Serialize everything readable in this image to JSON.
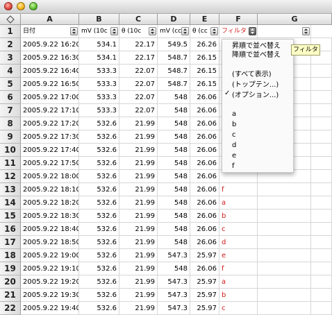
{
  "window": {
    "title": ""
  },
  "columns": [
    "",
    "A",
    "B",
    "C",
    "D",
    "E",
    "F",
    "G"
  ],
  "corner_icon": "diamond-icon",
  "header_row": {
    "row_number": "1",
    "cells": [
      "日付",
      "mV (10c",
      "θ (10c",
      "mV (cc",
      "θ (cc",
      "フィルタ",
      ""
    ]
  },
  "rows": [
    {
      "num": "2",
      "date": "2005.9.22 16:20",
      "b": "534.1",
      "c": "22.17",
      "d": "549.5",
      "e": "26.26",
      "f": ""
    },
    {
      "num": "3",
      "date": "2005.9.22 16:30",
      "b": "534.1",
      "c": "22.17",
      "d": "548.7",
      "e": "26.15",
      "f": ""
    },
    {
      "num": "4",
      "date": "2005.9.22 16:40",
      "b": "533.3",
      "c": "22.07",
      "d": "548.7",
      "e": "26.15",
      "f": ""
    },
    {
      "num": "5",
      "date": "2005.9.22 16:50",
      "b": "533.3",
      "c": "22.07",
      "d": "548.7",
      "e": "26.15",
      "f": ""
    },
    {
      "num": "6",
      "date": "2005.9.22 17:00",
      "b": "533.3",
      "c": "22.07",
      "d": "548",
      "e": "26.06",
      "f": ""
    },
    {
      "num": "7",
      "date": "2005.9.22 17:10",
      "b": "533.3",
      "c": "22.07",
      "d": "548",
      "e": "26.06",
      "f": ""
    },
    {
      "num": "8",
      "date": "2005.9.22 17:20",
      "b": "532.6",
      "c": "21.99",
      "d": "548",
      "e": "26.06",
      "f": ""
    },
    {
      "num": "9",
      "date": "2005.9.22 17:30",
      "b": "532.6",
      "c": "21.99",
      "d": "548",
      "e": "26.06",
      "f": ""
    },
    {
      "num": "10",
      "date": "2005.9.22 17:40",
      "b": "532.6",
      "c": "21.99",
      "d": "548",
      "e": "26.06",
      "f": ""
    },
    {
      "num": "11",
      "date": "2005.9.22 17:50",
      "b": "532.6",
      "c": "21.99",
      "d": "548",
      "e": "26.06",
      "f": ""
    },
    {
      "num": "12",
      "date": "2005.9.22 18:00",
      "b": "532.6",
      "c": "21.99",
      "d": "548",
      "e": "26.06",
      "f": ""
    },
    {
      "num": "13",
      "date": "2005.9.22 18:10",
      "b": "532.6",
      "c": "21.99",
      "d": "548",
      "e": "26.06",
      "f": "f"
    },
    {
      "num": "14",
      "date": "2005.9.22 18:20",
      "b": "532.6",
      "c": "21.99",
      "d": "548",
      "e": "26.06",
      "f": "a"
    },
    {
      "num": "15",
      "date": "2005.9.22 18:30",
      "b": "532.6",
      "c": "21.99",
      "d": "548",
      "e": "26.06",
      "f": "b"
    },
    {
      "num": "16",
      "date": "2005.9.22 18:40",
      "b": "532.6",
      "c": "21.99",
      "d": "548",
      "e": "26.06",
      "f": "c"
    },
    {
      "num": "17",
      "date": "2005.9.22 18:50",
      "b": "532.6",
      "c": "21.99",
      "d": "548",
      "e": "26.06",
      "f": "d"
    },
    {
      "num": "18",
      "date": "2005.9.22 19:00",
      "b": "532.6",
      "c": "21.99",
      "d": "547.3",
      "e": "25.97",
      "f": "e"
    },
    {
      "num": "19",
      "date": "2005.9.22 19:10",
      "b": "532.6",
      "c": "21.99",
      "d": "548",
      "e": "26.06",
      "f": "f"
    },
    {
      "num": "20",
      "date": "2005.9.22 19:20",
      "b": "532.6",
      "c": "21.99",
      "d": "547.3",
      "e": "25.97",
      "f": "a"
    },
    {
      "num": "21",
      "date": "2005.9.22 19:30",
      "b": "532.6",
      "c": "21.99",
      "d": "547.3",
      "e": "25.97",
      "f": "b"
    },
    {
      "num": "22",
      "date": "2005.9.22 19:40",
      "b": "532.6",
      "c": "21.99",
      "d": "547.3",
      "e": "25.97",
      "f": "c"
    }
  ],
  "filter_menu": {
    "items": [
      "昇順で並べ替え",
      "降順で並べ替え",
      "(すべて表示)",
      "(トップテン...)",
      "(オプション...)",
      "a",
      "b",
      "c",
      "d",
      "e",
      "f"
    ],
    "checked_item": "(すべて表示)",
    "check_mark": "✓"
  },
  "tooltip": "フィルタ",
  "colors": {
    "filter_text": "#d21a1a",
    "grid": "#d6d6d6",
    "header_bg": "#e6e6e6"
  }
}
